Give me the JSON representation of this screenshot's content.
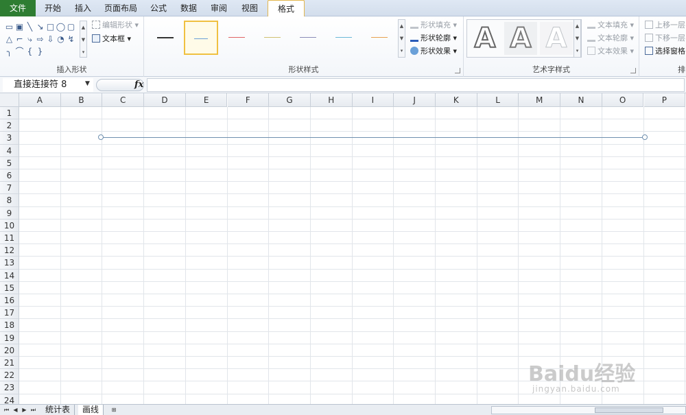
{
  "tabs": {
    "file": "文件",
    "items": [
      "开始",
      "插入",
      "页面布局",
      "公式",
      "数据",
      "审阅",
      "视图",
      "格式"
    ],
    "active_index": 7
  },
  "ribbon": {
    "insert_shapes": {
      "label": "插入形状",
      "edit_shape": "编辑形状",
      "text_box": "文本框",
      "shapes": [
        "▭",
        "▣",
        "╲",
        "↘",
        "□",
        "◯",
        "▢",
        "△",
        "⌐",
        "⤷",
        "⇨",
        "⇩",
        "◔",
        "↯",
        "╮",
        "⌒",
        "{",
        "}"
      ]
    },
    "shape_styles": {
      "label": "形状样式",
      "swatch_colors": [
        "#333333",
        "#6a9ed8",
        "#e06464",
        "#d0c070",
        "#8a8ab8",
        "#6ab8d8",
        "#e8a050"
      ],
      "selected_index": 1,
      "fill": "形状填充",
      "outline": "形状轮廓",
      "effects": "形状效果"
    },
    "wordart": {
      "label": "艺术字样式",
      "letter": "A",
      "fill": "文本填充",
      "outline": "文本轮廓",
      "effects": "文本效果"
    },
    "arrange": {
      "label": "排",
      "bring_forward": "上移一层",
      "send_backward": "下移一层",
      "selection_pane": "选择窗格"
    }
  },
  "formula_bar": {
    "name_box": "直接连接符 8",
    "fx": "fx",
    "formula": ""
  },
  "grid": {
    "columns": [
      "A",
      "B",
      "C",
      "D",
      "E",
      "F",
      "G",
      "H",
      "I",
      "J",
      "K",
      "L",
      "M",
      "N",
      "O",
      "P"
    ],
    "rows": [
      "1",
      "2",
      "3",
      "4",
      "5",
      "6",
      "7",
      "8",
      "9",
      "10",
      "11",
      "12",
      "13",
      "14",
      "15",
      "16",
      "17",
      "18",
      "19",
      "20",
      "21",
      "22",
      "23",
      "24"
    ]
  },
  "sheets": {
    "tabs": [
      "统计表",
      "画线"
    ],
    "active_index": 1
  },
  "watermark": {
    "main": "Baidu经验",
    "sub": "jingyan.baidu.com"
  }
}
